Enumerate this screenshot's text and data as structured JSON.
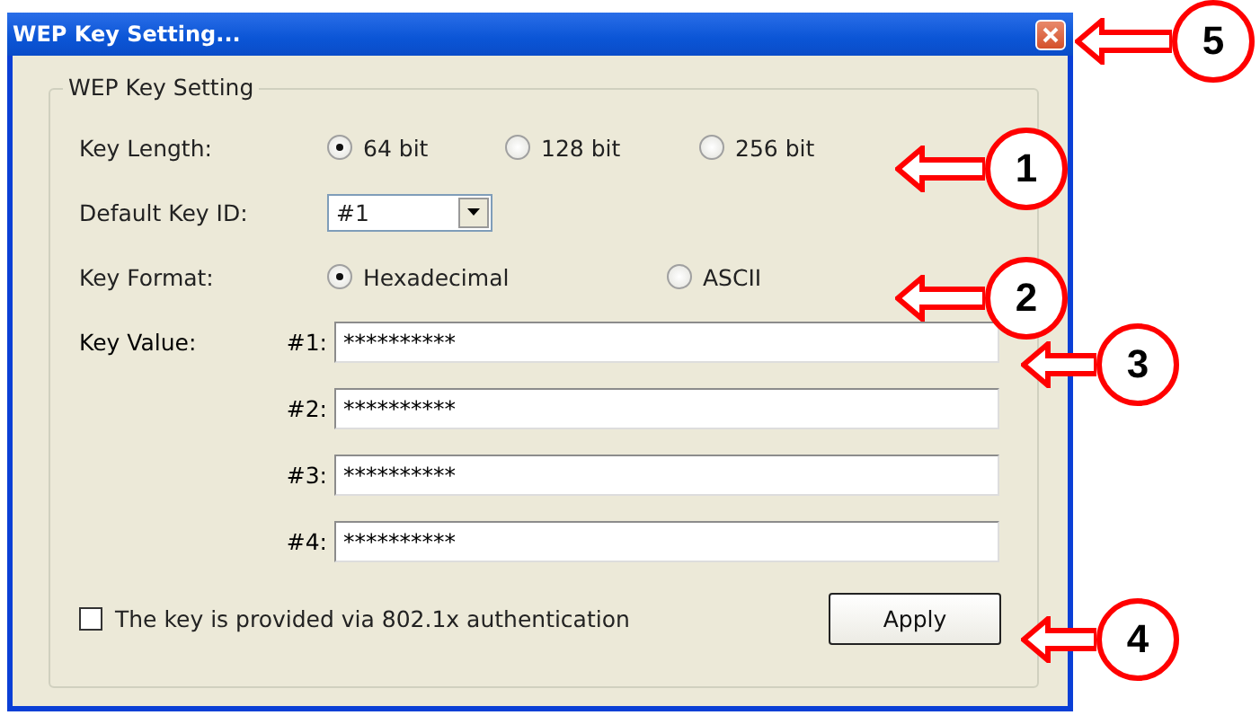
{
  "window": {
    "title": "WEP Key Setting..."
  },
  "group": {
    "title": "WEP Key Setting"
  },
  "key_length": {
    "label": "Key Length:",
    "options": [
      {
        "label": "64 bit",
        "selected": true
      },
      {
        "label": "128 bit",
        "selected": false
      },
      {
        "label": "256 bit",
        "selected": false
      }
    ]
  },
  "default_key_id": {
    "label": "Default Key ID:",
    "value": "#1"
  },
  "key_format": {
    "label": "Key Format:",
    "options": [
      {
        "label": "Hexadecimal",
        "selected": true
      },
      {
        "label": "ASCII",
        "selected": false
      }
    ]
  },
  "key_value": {
    "label": "Key Value:",
    "keys": [
      {
        "label": "#1:",
        "value": "**********"
      },
      {
        "label": "#2:",
        "value": "**********"
      },
      {
        "label": "#3:",
        "value": "**********"
      },
      {
        "label": "#4:",
        "value": "**********"
      }
    ]
  },
  "checkbox": {
    "label": "The key is provided via 802.1x authentication",
    "checked": false
  },
  "apply_button": "Apply",
  "callouts": [
    {
      "number": "5"
    },
    {
      "number": "1"
    },
    {
      "number": "2"
    },
    {
      "number": "3"
    },
    {
      "number": "4"
    }
  ]
}
